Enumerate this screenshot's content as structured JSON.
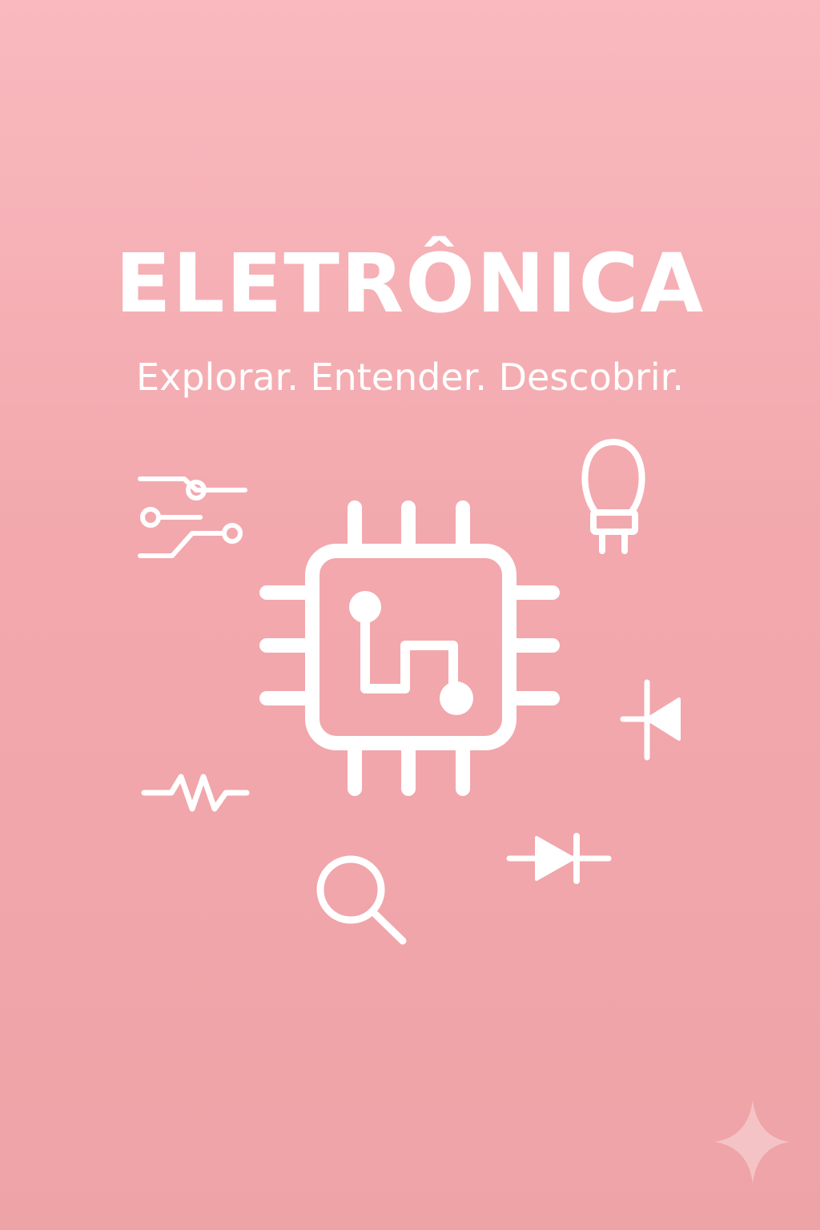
{
  "title": "ELETRÔNICA",
  "subtitle": "Explorar. Entender. Descobrir.",
  "colors": {
    "background_top": "#f9b9be",
    "background_bottom": "#eea3a7",
    "foreground": "#ffffff"
  },
  "icons": [
    "circuit-traces-icon",
    "microchip-icon",
    "light-bulb-icon",
    "diode-vertical-icon",
    "resistor-icon",
    "magnifier-icon",
    "diode-horizontal-icon",
    "sparkle-icon"
  ]
}
